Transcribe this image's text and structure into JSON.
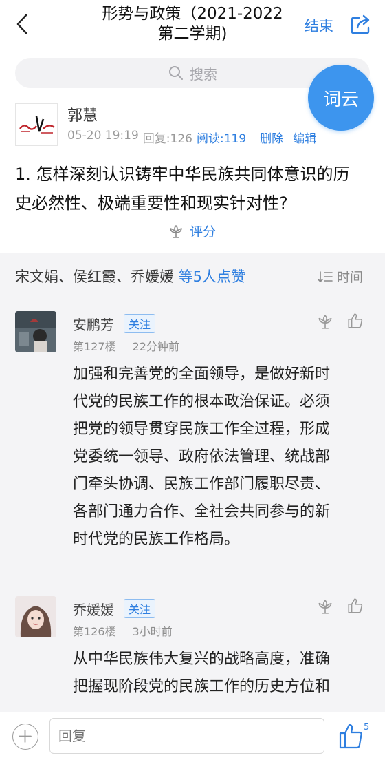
{
  "header": {
    "title_line1": "形势与政策（2021-2022",
    "title_line2": "第二学期)",
    "end_label": "结束"
  },
  "search": {
    "placeholder": "搜索"
  },
  "floating": {
    "word_cloud": "词云"
  },
  "post": {
    "author": "郭慧",
    "date": "05-20 19:19",
    "reply_count": "回复:126",
    "read_count": "阅读:119",
    "delete_label": "删除",
    "edit_label": "编辑",
    "question_line1": "1. 怎样深刻认识铸牢中华民族共同体意识的历",
    "question_line2": "史必然性、极端重要性和现实针对性?",
    "rate_label": "评分"
  },
  "likes": {
    "names": "宋文娟、侯红霞、乔媛媛",
    "count_text": "等5人点赞",
    "sort_label": "时间"
  },
  "comments": [
    {
      "name": "安鹏芳",
      "follow_label": "关注",
      "floor": "第127楼",
      "time": "22分钟前",
      "lines": [
        "加强和完善党的全面领导，是做好新时",
        "代党的民族工作的根本政治保证。必须",
        "把党的领导贯穿民族工作全过程，形成",
        "党委统一领导、政府依法管理、统战部",
        "门牵头协调、民族工作部门履职尽责、",
        "各部门通力合作、全社会共同参与的新",
        "时代党的民族工作格局。"
      ]
    },
    {
      "name": "乔媛媛",
      "follow_label": "关注",
      "floor": "第126楼",
      "time": "3小时前",
      "lines": [
        "从中华民族伟大复兴的战略高度，准确",
        "把握现阶段党的民族工作的历史方位和"
      ]
    }
  ],
  "bottom": {
    "reply_placeholder": "回复",
    "like_count": "5"
  }
}
